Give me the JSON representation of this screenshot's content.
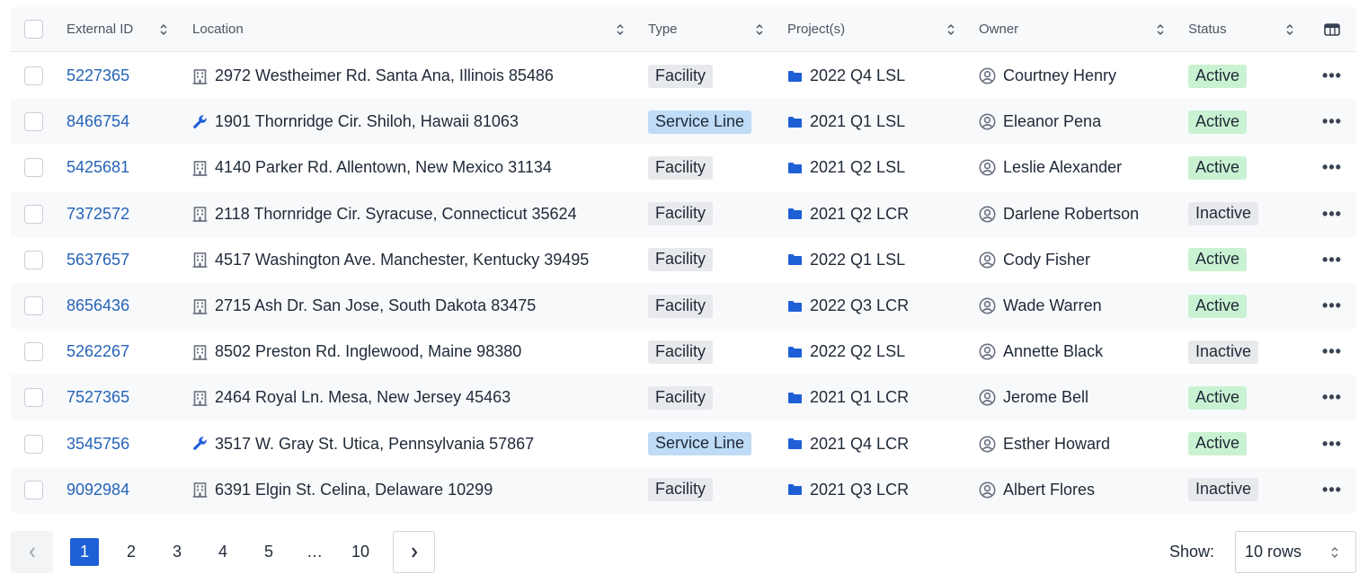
{
  "table": {
    "headers": {
      "external_id": "External ID",
      "location": "Location",
      "type": "Type",
      "projects": "Project(s)",
      "owner": "Owner",
      "status": "Status"
    },
    "rows": [
      {
        "id": "5227365",
        "location": "2972 Westheimer Rd. Santa Ana, Illinois 85486",
        "location_icon": "building-icon",
        "type": "Facility",
        "project": "2022 Q4 LSL",
        "owner": "Courtney Henry",
        "status": "Active"
      },
      {
        "id": "8466754",
        "location": "1901 Thornridge Cir. Shiloh, Hawaii 81063",
        "location_icon": "wrench-icon",
        "type": "Service Line",
        "project": "2021 Q1 LSL",
        "owner": "Eleanor Pena",
        "status": "Active"
      },
      {
        "id": "5425681",
        "location": "4140 Parker Rd. Allentown, New Mexico 31134",
        "location_icon": "building-icon",
        "type": "Facility",
        "project": "2021 Q2 LSL",
        "owner": "Leslie Alexander",
        "status": "Active"
      },
      {
        "id": "7372572",
        "location": "2118 Thornridge Cir. Syracuse, Connecticut 35624",
        "location_icon": "building-icon",
        "type": "Facility",
        "project": "2021 Q2 LCR",
        "owner": "Darlene Robertson",
        "status": "Inactive"
      },
      {
        "id": "5637657",
        "location": "4517 Washington Ave. Manchester, Kentucky 39495",
        "location_icon": "building-icon",
        "type": "Facility",
        "project": "2022 Q1 LSL",
        "owner": "Cody Fisher",
        "status": "Active"
      },
      {
        "id": "8656436",
        "location": "2715 Ash Dr. San Jose, South Dakota 83475",
        "location_icon": "building-icon",
        "type": "Facility",
        "project": "2022 Q3 LCR",
        "owner": "Wade Warren",
        "status": "Active"
      },
      {
        "id": "5262267",
        "location": "8502 Preston Rd. Inglewood, Maine 98380",
        "location_icon": "building-icon",
        "type": "Facility",
        "project": "2022 Q2 LSL",
        "owner": "Annette Black",
        "status": "Inactive"
      },
      {
        "id": "7527365",
        "location": "2464 Royal Ln. Mesa, New Jersey 45463",
        "location_icon": "building-icon",
        "type": "Facility",
        "project": "2021 Q1 LCR",
        "owner": "Jerome Bell",
        "status": "Active"
      },
      {
        "id": "3545756",
        "location": "3517 W. Gray St. Utica, Pennsylvania 57867",
        "location_icon": "wrench-icon",
        "type": "Service Line",
        "project": "2021 Q4 LCR",
        "owner": "Esther Howard",
        "status": "Active"
      },
      {
        "id": "9092984",
        "location": "6391 Elgin St. Celina, Delaware 10299",
        "location_icon": "building-icon",
        "type": "Facility",
        "project": "2021 Q3 LCR",
        "owner": "Albert Flores",
        "status": "Inactive"
      }
    ],
    "more_label": "•••"
  },
  "pagination": {
    "pages": [
      "1",
      "2",
      "3",
      "4",
      "5",
      "…",
      "10"
    ],
    "current": "1",
    "show_label": "Show:",
    "rows_value": "10 rows"
  },
  "colors": {
    "link": "#2563b8",
    "active_badge": "#c9f2d2",
    "inactive_badge": "#e8e9ec",
    "service_badge": "#bfdbf6",
    "current_page": "#1f5fd6",
    "folder_icon": "#1f5fd6"
  }
}
